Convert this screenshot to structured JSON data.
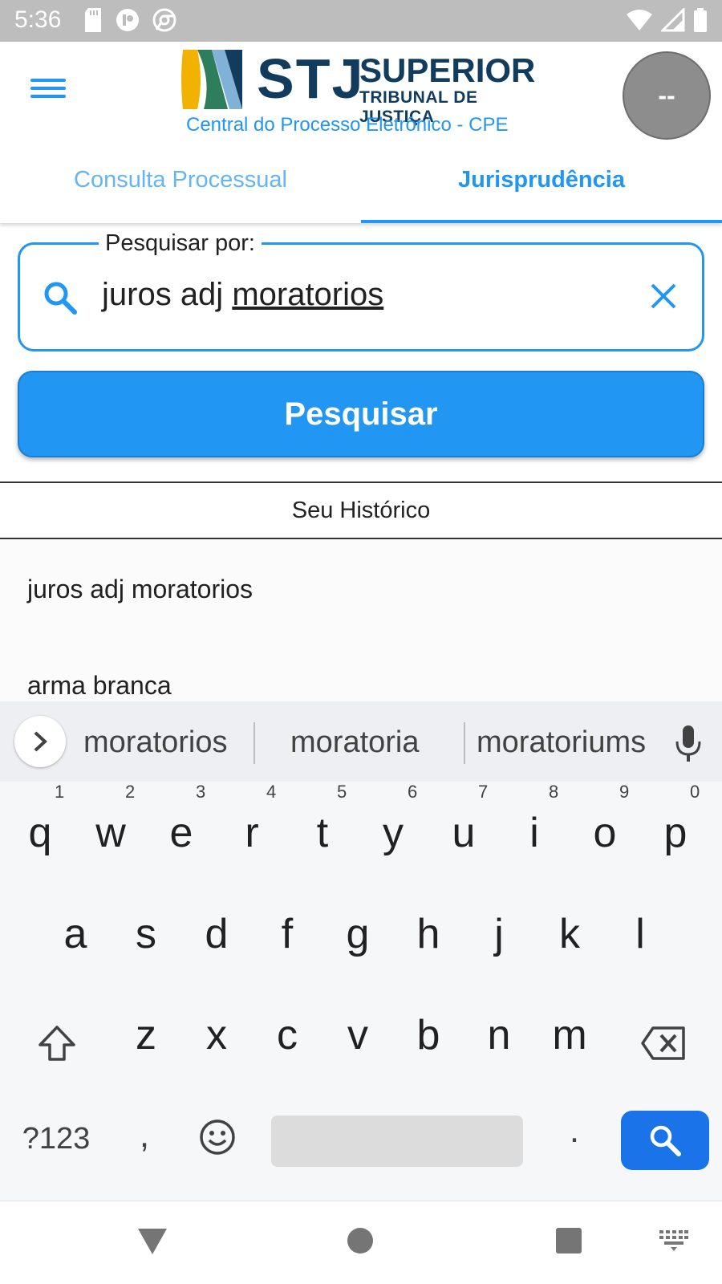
{
  "status_bar": {
    "time": "5:36"
  },
  "header": {
    "logo_stj": "STJ",
    "logo_superior": "SUPERIOR",
    "logo_tribunal": "TRIBUNAL DE JUSTIÇA",
    "logo_subtitle": "Central do Processo Eletrônico - CPE",
    "avatar_text": "--"
  },
  "tabs": [
    {
      "label": "Consulta Processual",
      "active": false
    },
    {
      "label": "Jurisprudência",
      "active": true
    }
  ],
  "search": {
    "legend": "Pesquisar por:",
    "value_plain": "juros adj ",
    "value_underlined": "moratorios"
  },
  "search_button_label": "Pesquisar",
  "history": {
    "title": "Seu Histórico",
    "items": [
      "juros adj moratorios",
      "arma branca"
    ]
  },
  "suggestions": [
    "moratorios",
    "moratoria",
    "moratoriums"
  ],
  "keyboard": {
    "row1": [
      "q",
      "w",
      "e",
      "r",
      "t",
      "y",
      "u",
      "i",
      "o",
      "p"
    ],
    "row1_hints": [
      "1",
      "2",
      "3",
      "4",
      "5",
      "6",
      "7",
      "8",
      "9",
      "0"
    ],
    "row2": [
      "a",
      "s",
      "d",
      "f",
      "g",
      "h",
      "j",
      "k",
      "l"
    ],
    "row3": [
      "z",
      "x",
      "c",
      "v",
      "b",
      "n",
      "m"
    ],
    "symbols_label": "?123",
    "comma": ",",
    "period": "."
  },
  "colors": {
    "accent": "#2196f3",
    "logo_navy": "#123c5d",
    "keyboard_search": "#1a73e8"
  }
}
